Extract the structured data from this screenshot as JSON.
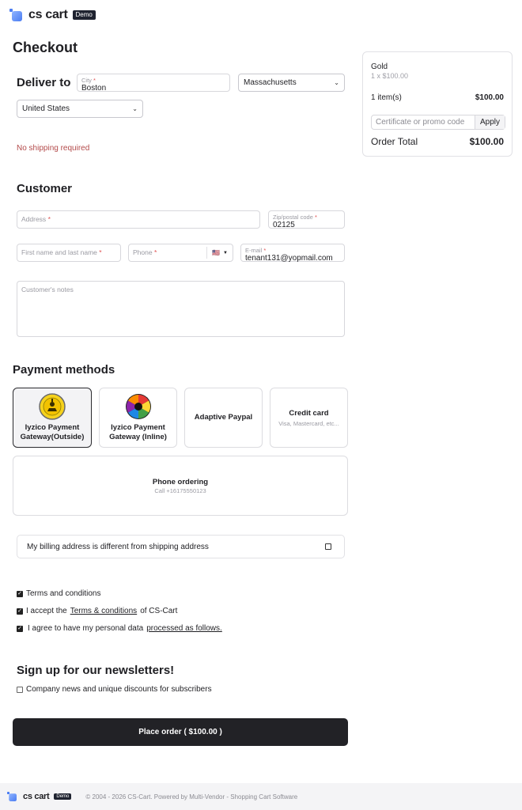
{
  "header": {
    "brand": "cs cart",
    "badge": "Demo"
  },
  "page_title": "Checkout",
  "deliver": {
    "title": "Deliver to",
    "city": {
      "label": "City",
      "value": "Boston"
    },
    "state": "Massachusetts",
    "country": "United States",
    "no_shipping": "No shipping required"
  },
  "customer": {
    "title": "Customer",
    "address": {
      "label": "Address"
    },
    "zip": {
      "label": "Zip/postal code",
      "value": "02125"
    },
    "name": {
      "label": "First name and last name"
    },
    "phone": {
      "label": "Phone",
      "flag": "🇺🇸"
    },
    "email": {
      "label": "E-mail",
      "value": "tenant131@yopmail.com"
    },
    "notes": {
      "label": "Customer's notes"
    }
  },
  "payment": {
    "title": "Payment methods",
    "methods": [
      {
        "name": "Iyzico Payment Gateway(Outside)"
      },
      {
        "name": "Iyzico Payment Gateway (Inline)"
      },
      {
        "name": "Adaptive Paypal"
      },
      {
        "name": "Credit card",
        "sub": "Visa, Mastercard, etc..."
      },
      {
        "name": "Phone ordering",
        "sub": "Call +16175550123"
      }
    ]
  },
  "billing": {
    "label": "My billing address is different from shipping address"
  },
  "terms": {
    "terms_conditions": "Terms and conditions",
    "accept_prefix": "I accept the",
    "accept_link": "Terms & conditions",
    "accept_suffix": "of CS-Cart",
    "personal_prefix": "I agree to have my personal data",
    "personal_link": "processed as follows."
  },
  "newsletter": {
    "title": "Sign up for our newsletters!",
    "option": "Company news and unique discounts for subscribers"
  },
  "place_order": "Place order ( $100.00 )",
  "summary": {
    "product": "Gold",
    "product_qty": "1 x $100.00",
    "items_label": "1 item(s)",
    "items_total": "$100.00",
    "promo_placeholder": "Certificate or promo code",
    "apply": "Apply",
    "order_total_label": "Order Total",
    "order_total": "$100.00"
  },
  "footer": {
    "brand": "cs cart",
    "badge": "Demo",
    "copyright": "© 2004 - 2026 CS-Cart.  Powered by Multi-Vendor - Shopping Cart Software"
  }
}
